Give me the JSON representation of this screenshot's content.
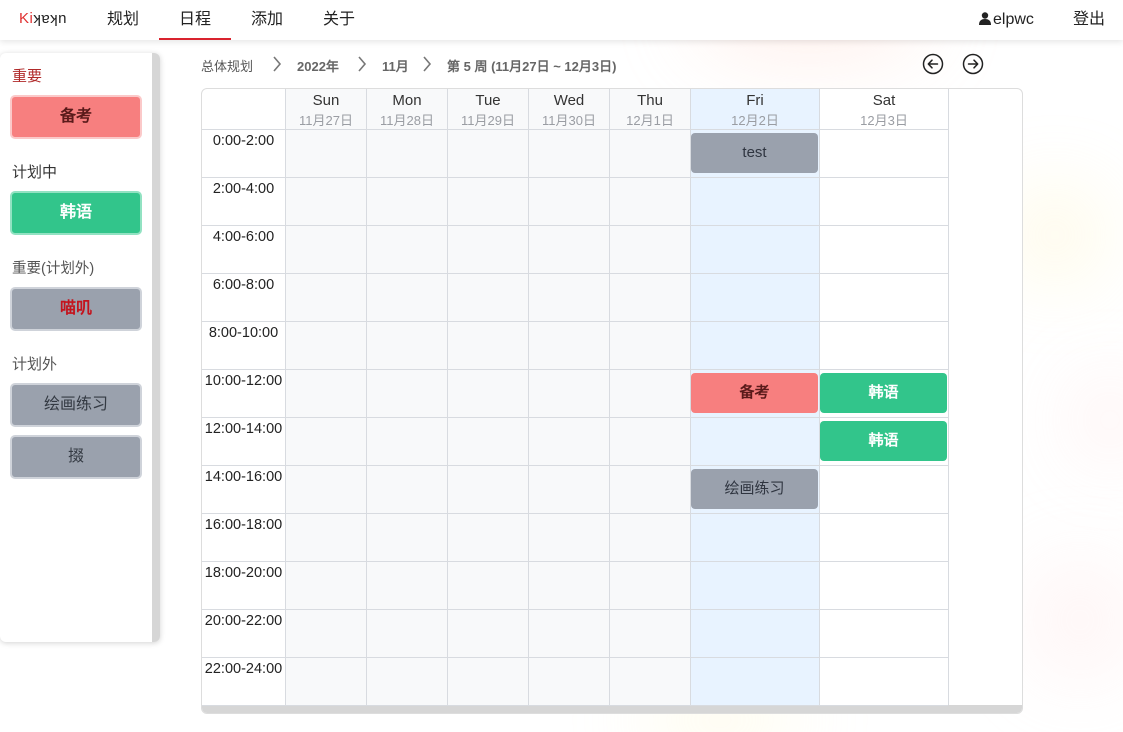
{
  "nav": {
    "logo_accent": "Ki",
    "logo_rest": "ʞɐʞn",
    "items": [
      "规划",
      "日程",
      "添加",
      "关于"
    ],
    "active": "日程",
    "username": "elpwc",
    "logout": "登出"
  },
  "sidebar": {
    "sections": [
      {
        "title": "重要",
        "items": [
          "备考"
        ]
      },
      {
        "title": "计划中",
        "items": [
          "韩语"
        ]
      },
      {
        "title": "重要(计划外)",
        "items": [
          "喵叽"
        ]
      },
      {
        "title": "计划外",
        "items": [
          "绘画练习",
          "掇"
        ]
      }
    ]
  },
  "breadcrumb": {
    "root": "总体规划",
    "year": "2022年",
    "month": "11月",
    "week": "第 5 周 (11月27日 ~ 12月3日)"
  },
  "calendar": {
    "days": [
      {
        "name": "Sun",
        "date": "11月27日"
      },
      {
        "name": "Mon",
        "date": "11月28日"
      },
      {
        "name": "Tue",
        "date": "11月29日"
      },
      {
        "name": "Wed",
        "date": "11月30日"
      },
      {
        "name": "Thu",
        "date": "12月1日"
      },
      {
        "name": "Fri",
        "date": "12月2日"
      },
      {
        "name": "Sat",
        "date": "12月3日"
      }
    ],
    "highlight_day": "Fri",
    "slots": [
      "0:00-2:00",
      "2:00-4:00",
      "4:00-6:00",
      "6:00-8:00",
      "8:00-10:00",
      "10:00-12:00",
      "12:00-14:00",
      "14:00-16:00",
      "16:00-18:00",
      "18:00-20:00",
      "20:00-22:00",
      "22:00-24:00"
    ],
    "events": [
      {
        "day": "Fri",
        "slot": "0:00-2:00",
        "title": "test",
        "category": "计划外"
      },
      {
        "day": "Fri",
        "slot": "10:00-12:00",
        "title": "备考",
        "category": "重要"
      },
      {
        "day": "Sat",
        "slot": "10:00-12:00",
        "title": "韩语",
        "category": "计划中"
      },
      {
        "day": "Sat",
        "slot": "12:00-14:00",
        "title": "韩语",
        "category": "计划中"
      },
      {
        "day": "Fri",
        "slot": "14:00-16:00",
        "title": "绘画练习",
        "category": "计划外"
      }
    ]
  },
  "colors": {
    "important": "#f77f7f",
    "planned": "#32c58b",
    "unplanned": "#9aa1ad",
    "highlight_column": "#e8f3ff",
    "accent_red": "#d9232e"
  }
}
